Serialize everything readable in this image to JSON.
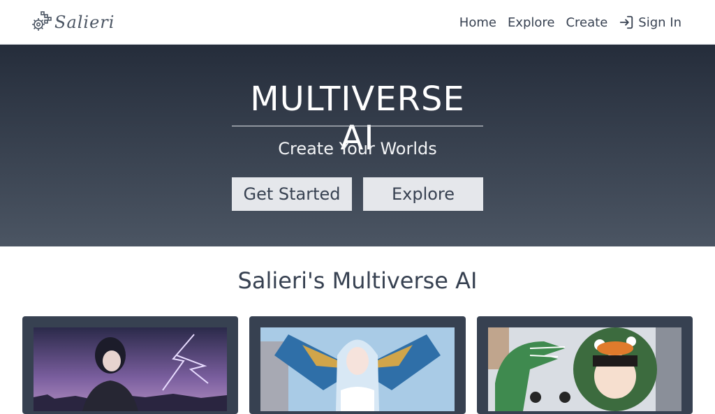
{
  "brand": {
    "name": "Salieri"
  },
  "nav": {
    "items": [
      "Home",
      "Explore",
      "Create"
    ],
    "signin": "Sign In"
  },
  "hero": {
    "title": "MULTIVERSE AI",
    "subtitle": "Create Your Worlds",
    "primary_button": "Get Started",
    "secondary_button": "Explore"
  },
  "section": {
    "title": "Salieri's Multiverse AI"
  },
  "colors": {
    "header_bg": "#ffffff",
    "hero_top": "#252d3b",
    "hero_bottom": "#4b5563",
    "button_bg": "#e5e7eb",
    "card_bg": "#374151"
  }
}
